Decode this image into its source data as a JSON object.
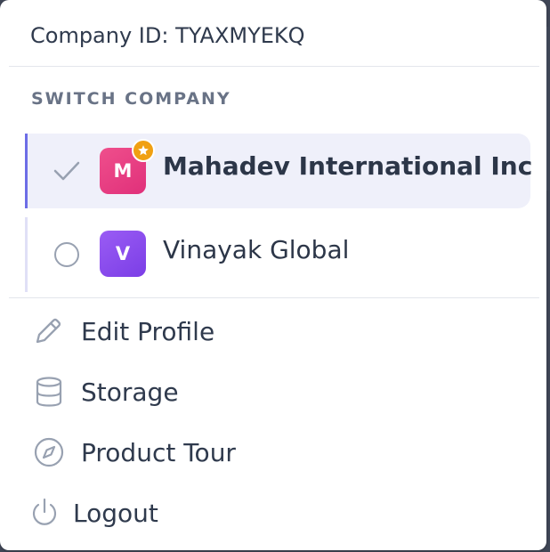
{
  "header": {
    "company_id_text": "Company ID: TYAXMYEKQ"
  },
  "switch_company": {
    "section_label": "SWITCH COMPANY",
    "companies": [
      {
        "name": "Mahadev International Inc",
        "initial": "M",
        "selected": true,
        "starred": true,
        "avatar_color": "#e8357f"
      },
      {
        "name": "Vinayak Global",
        "initial": "V",
        "selected": false,
        "starred": false,
        "avatar_color": "#8847ee"
      }
    ]
  },
  "menu": {
    "items": [
      {
        "label": "Edit Profile",
        "icon": "pencil-icon"
      },
      {
        "label": "Storage",
        "icon": "database-icon"
      },
      {
        "label": "Product Tour",
        "icon": "compass-icon"
      },
      {
        "label": "Logout",
        "icon": "power-icon"
      }
    ]
  },
  "colors": {
    "accent": "#6d6de6",
    "active_row_bg": "#eff0fa",
    "text": "#2f3a4d",
    "icon_gray": "#98a1b1",
    "star_badge": "#f0a012"
  }
}
